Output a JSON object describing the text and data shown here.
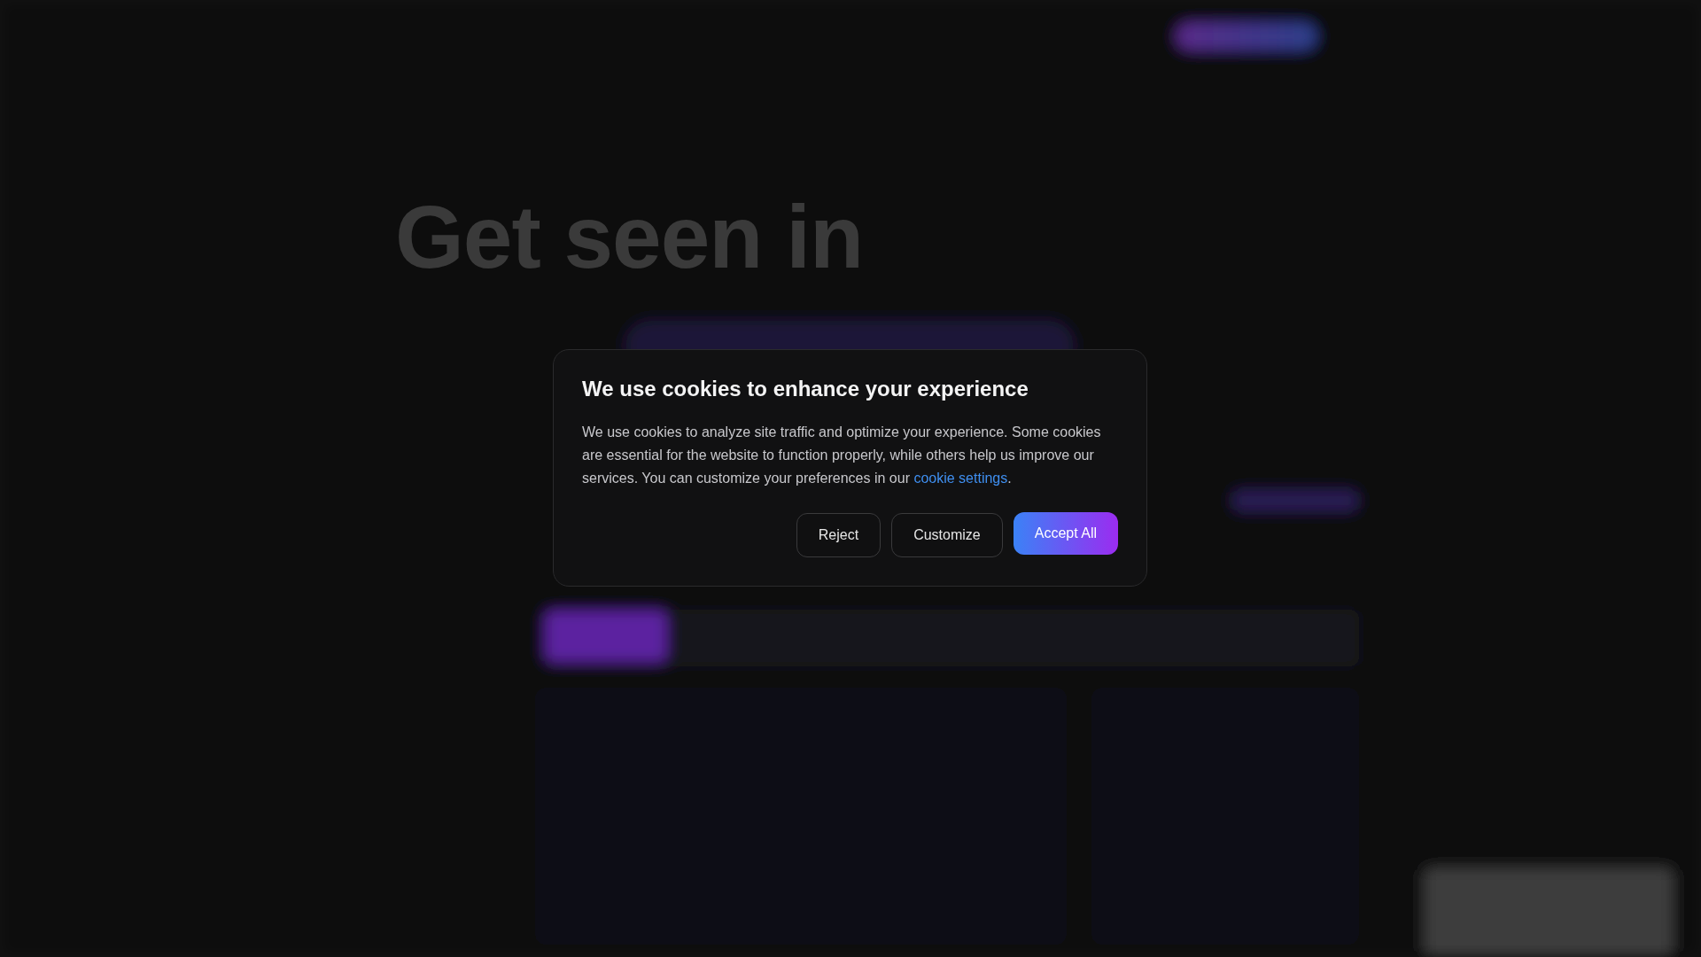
{
  "hero": {
    "heading": "Get seen in"
  },
  "cookie_dialog": {
    "title": "We use cookies to enhance your experience",
    "body": "We use cookies to analyze site traffic and optimize your experience. Some cookies are essential for the website to function properly, while others help us improve our services. You can customize your preferences in our",
    "link": "cookie settings",
    "after_link": ".",
    "buttons": [
      {
        "label": "Reject",
        "kind": "secondary"
      },
      {
        "label": "Customize",
        "kind": "secondary"
      },
      {
        "label": "Accept All",
        "kind": "primary"
      }
    ]
  }
}
